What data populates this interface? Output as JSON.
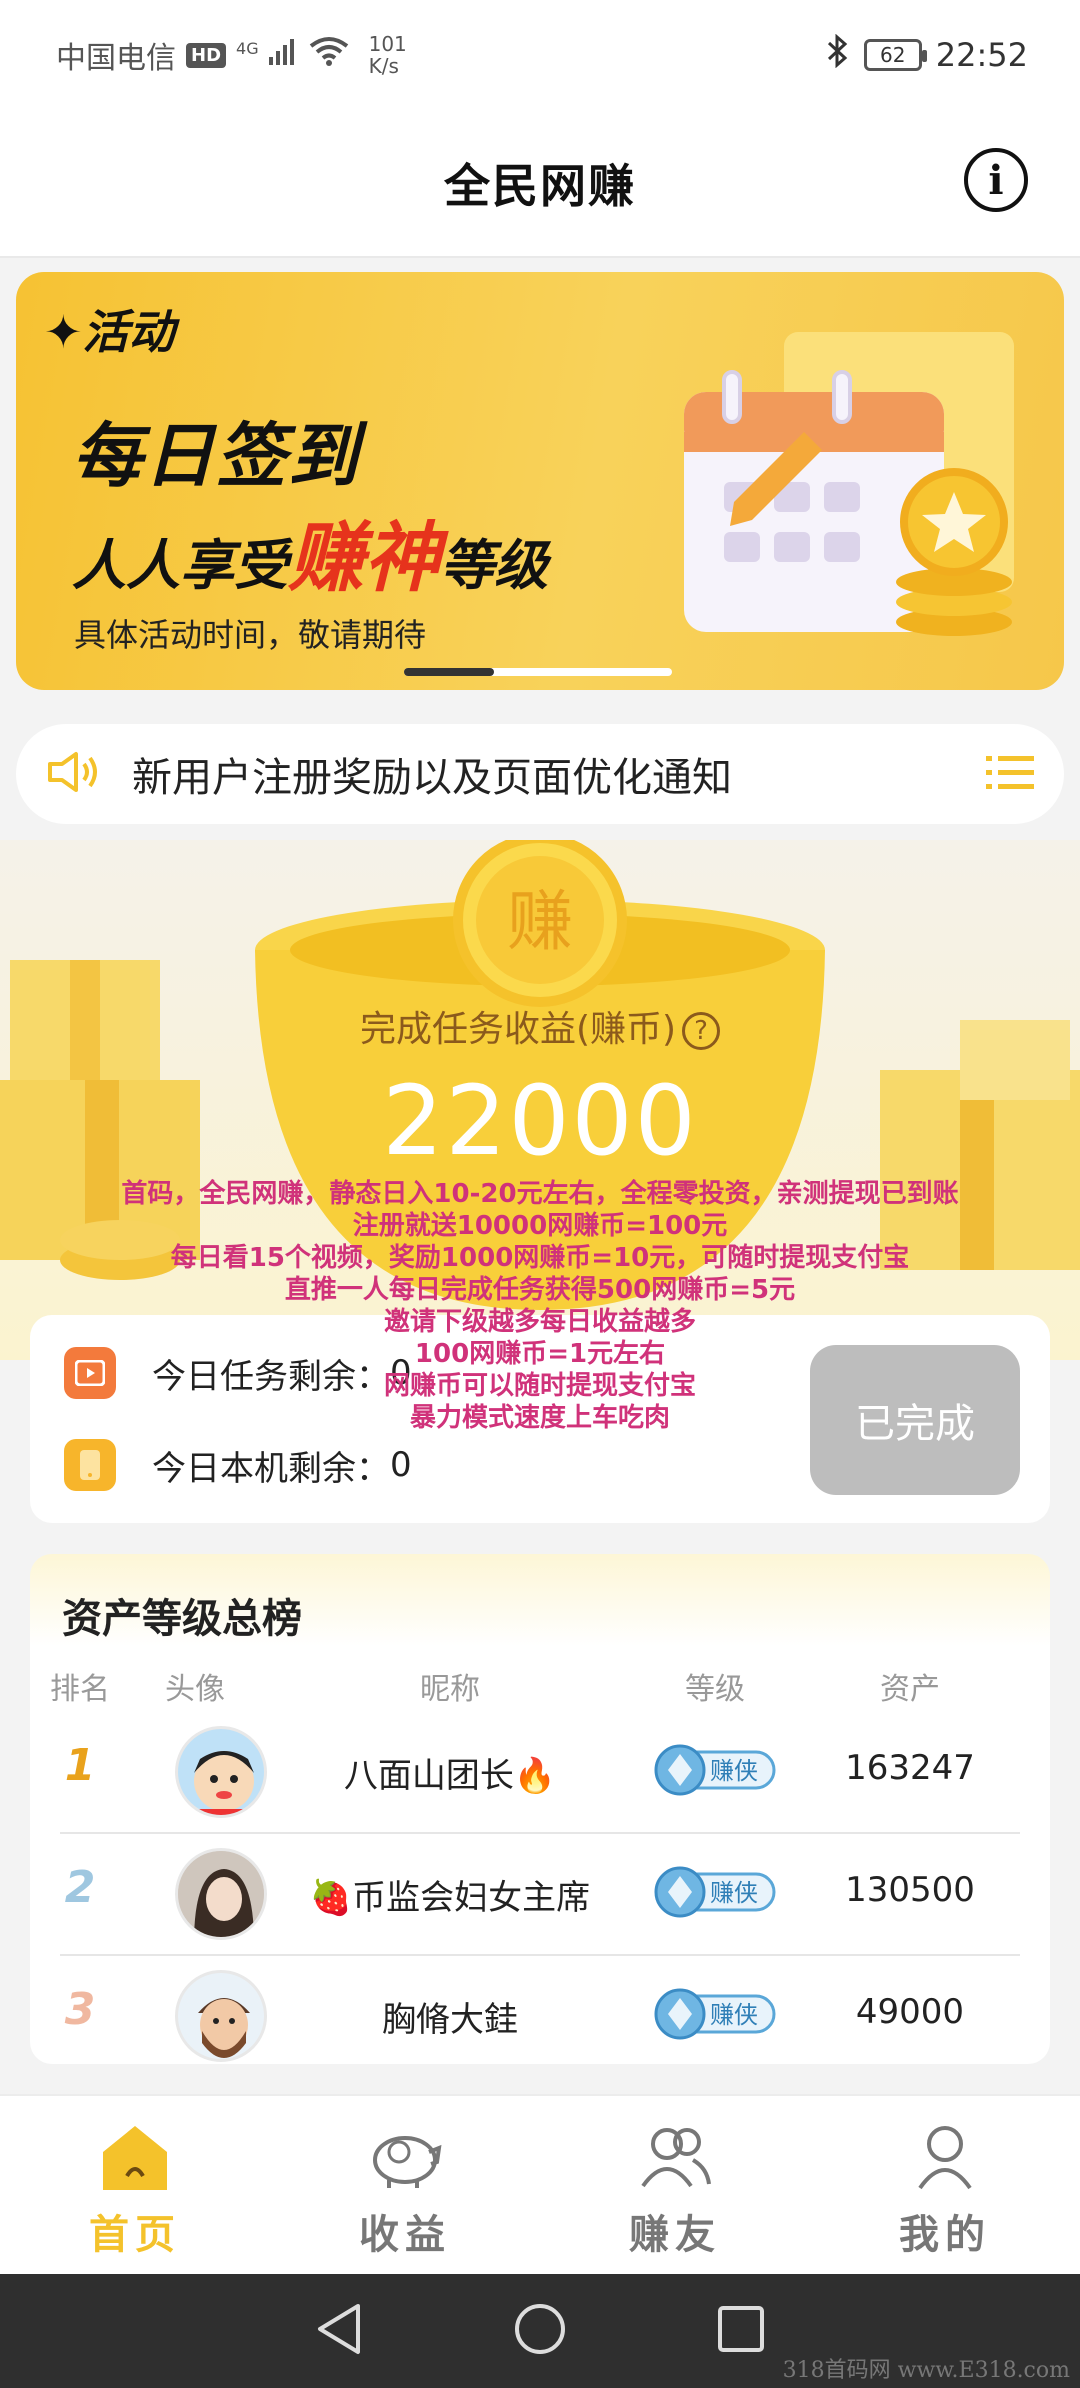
{
  "status_bar": {
    "carrier": "中国电信",
    "hd_badge": "HD",
    "signal_type": "4G",
    "net_speed_value": "101",
    "net_speed_unit": "K/s",
    "battery": "62",
    "time": "22:52"
  },
  "header": {
    "title": "全民网赚",
    "info_icon": "info-icon"
  },
  "banner": {
    "tag": "活动",
    "headline": "每日签到",
    "line2_prefix": "人人享受",
    "line2_accent": "赚神",
    "line2_suffix": "等级",
    "subtitle": "具体活动时间，敬请期待",
    "accent_color": "#e6331c"
  },
  "notice": {
    "text": "新用户注册奖励以及页面优化通知"
  },
  "earnings": {
    "coin_char": "赚",
    "label": "完成任务收益(赚币)",
    "value": "22000"
  },
  "promo_lines": [
    "首码，全民网赚，静态日入10-20元左右，全程零投资，亲测提现已到账",
    "注册就送10000网赚币=100元",
    "每日看15个视频，奖励1000网赚币=10元，可随时提现支付宝",
    "直推一人每日完成任务获得500网赚币=5元",
    "邀请下级越多每日收益越多",
    "100网赚币=1元左右",
    "网赚币可以随时提现支付宝",
    "暴力模式速度上车吃肉"
  ],
  "tasks": {
    "today_tasks_label": "今日任务剩余：",
    "today_tasks_value": "0",
    "device_label": "今日本机剩余：",
    "device_value": "0",
    "done_button": "已完成"
  },
  "ranking": {
    "title": "资产等级总榜",
    "columns": [
      "排名",
      "头像",
      "昵称",
      "等级",
      "资产"
    ],
    "level_badge": "赚侠",
    "rows": [
      {
        "rank": "1",
        "name": "八面山团长🔥",
        "asset": "163247"
      },
      {
        "rank": "2",
        "name": "🍓币监会妇女主席",
        "asset": "130500"
      },
      {
        "rank": "3",
        "name": "胸脩大銈",
        "asset": "49000"
      }
    ]
  },
  "bottom_nav": [
    {
      "label": "首页",
      "icon": "home-icon",
      "active": true
    },
    {
      "label": "收益",
      "icon": "piggy-bank-icon",
      "active": false
    },
    {
      "label": "赚友",
      "icon": "friends-icon",
      "active": false
    },
    {
      "label": "我的",
      "icon": "person-icon",
      "active": false
    }
  ],
  "watermark": "318首码网 www.E318.com"
}
